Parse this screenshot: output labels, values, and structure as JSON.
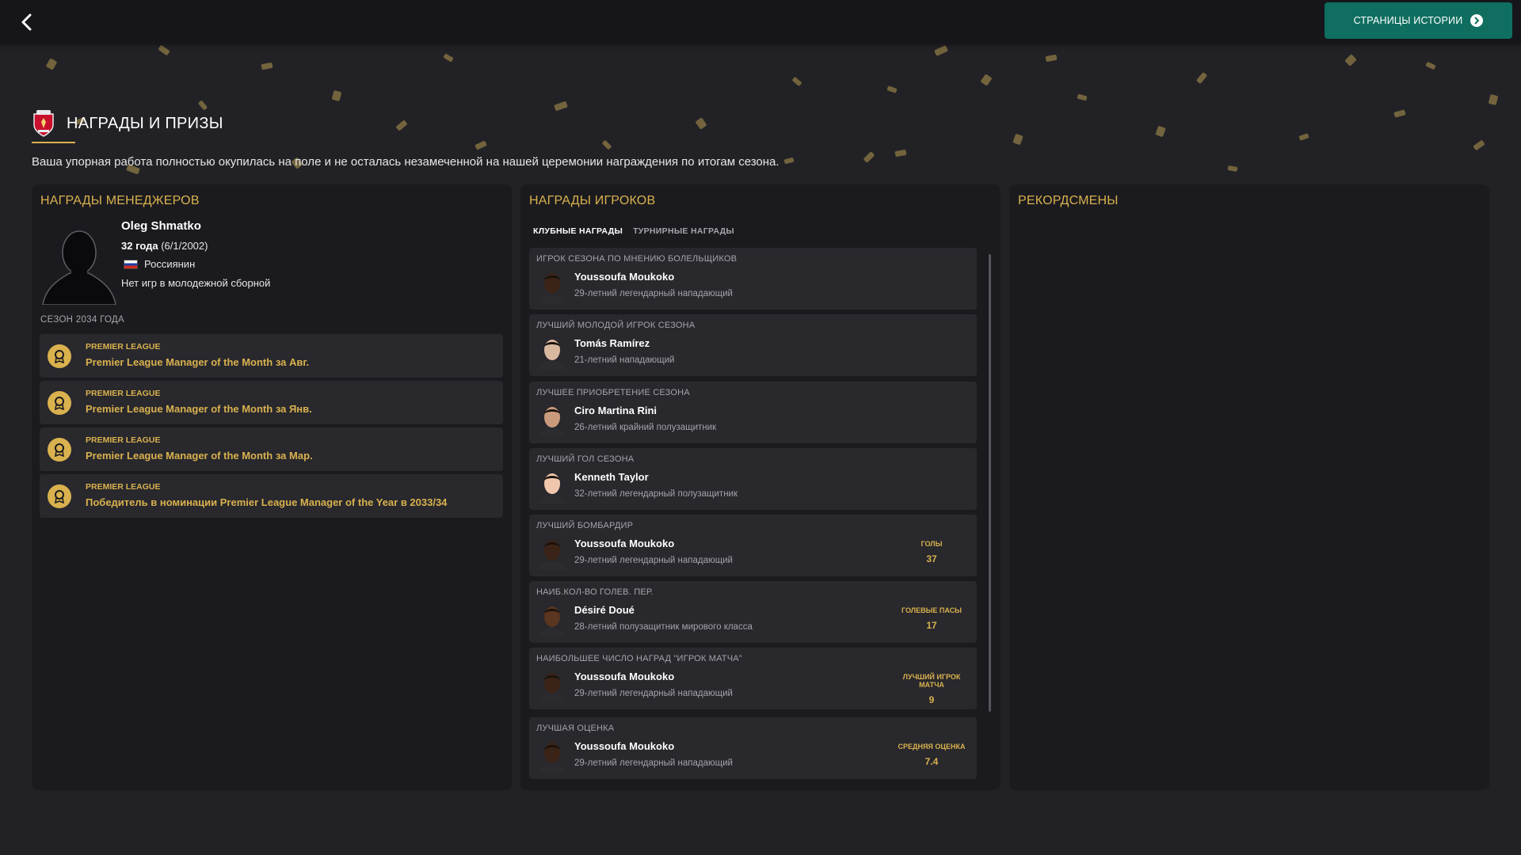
{
  "topbar": {
    "history_label": "СТРАНИЦЫ ИСТОРИИ"
  },
  "header": {
    "title": "НАГРАДЫ И ПРИЗЫ",
    "subtitle": "Ваша упорная работа полностью окупилась на поле и не осталась незамеченной на нашей церемонии награждения по итогам сезона."
  },
  "managers": {
    "title": "НАГРАДЫ МЕНЕДЖЕРОВ",
    "name": "Oleg Shmatko",
    "age": "32 года",
    "dob": "(6/1/2002)",
    "nationality": "Россиянин",
    "youth_caps": "Нет игр в молодежной сборной",
    "season_label": "СЕЗОН 2034 ГОДА",
    "awards": [
      {
        "league": "PREMIER LEAGUE",
        "text": "Premier League Manager of the Month за Авг."
      },
      {
        "league": "PREMIER LEAGUE",
        "text": "Premier League Manager of the Month за Янв."
      },
      {
        "league": "PREMIER LEAGUE",
        "text": "Premier League Manager of the Month за Мар."
      },
      {
        "league": "PREMIER LEAGUE",
        "text": "Победитель в номинации Premier League Manager of the Year в 2033/34"
      }
    ]
  },
  "players": {
    "title": "НАГРАДЫ ИГРОКОВ",
    "tabs": [
      {
        "label": "КЛУБНЫЕ НАГРАДЫ",
        "active": true
      },
      {
        "label": "ТУРНИРНЫЕ НАГРАДЫ",
        "active": false
      }
    ],
    "awards": [
      {
        "title": "ИГРОК СЕЗОНА ПО МНЕНИЮ БОЛЕЛЬЩИКОВ",
        "name": "Youssoufa Moukoko",
        "desc": "29-летний легендарный нападающий",
        "skin": "#3b2417"
      },
      {
        "title": "ЛУЧШИЙ МОЛОДОЙ ИГРОК СЕЗОНА",
        "name": "Tomás Ramírez",
        "desc": "21-летний нападающий",
        "skin": "#d9b8a0"
      },
      {
        "title": "ЛУЧШЕЕ ПРИОБРЕТЕНИЕ СЕЗОНА",
        "name": "Ciro Martina Rini",
        "desc": "26-летний крайний полузащитник",
        "skin": "#c99a7c"
      },
      {
        "title": "ЛУЧШИЙ ГОЛ СЕЗОНА",
        "name": "Kenneth Taylor",
        "desc": "32-летний легендарный полузащитник",
        "skin": "#f0c7ad"
      },
      {
        "title": "ЛУЧШИЙ БОМБАРДИР",
        "name": "Youssoufa Moukoko",
        "desc": "29-летний легендарный нападающий",
        "skin": "#3b2417",
        "stat_label": "ГОЛЫ",
        "stat_value": "37"
      },
      {
        "title": "НАИБ.КОЛ-ВО ГОЛЕВ. ПЕР.",
        "name": "Désiré Doué",
        "desc": "28-летний полузащитник мирового класса",
        "skin": "#5a3520",
        "stat_label": "ГОЛЕВЫЕ ПАСЫ",
        "stat_value": "17"
      },
      {
        "title": "НАИБОЛЬШЕЕ ЧИСЛО НАГРАД \"ИГРОК МАТЧА\"",
        "name": "Youssoufa Moukoko",
        "desc": "29-летний легендарный нападающий",
        "skin": "#3b2417",
        "stat_label": "ЛУЧШИЙ ИГРОК МАТЧА",
        "stat_value": "9"
      },
      {
        "title": "ЛУЧШАЯ ОЦЕНКА",
        "name": "Youssoufa Moukoko",
        "desc": "29-летний легендарный нападающий",
        "skin": "#3b2417",
        "stat_label": "СРЕДНЯЯ ОЦЕНКА",
        "stat_value": "7.4"
      }
    ]
  },
  "records": {
    "title": "РЕКОРДСМЕНЫ"
  },
  "colors": {
    "accent_gold": "#d9b14e",
    "button_teal": "#0f6e5f",
    "panel_bg": "#1b1b1f",
    "card_bg": "#28282d"
  },
  "icons": [
    "back-arrow-icon",
    "chevron-right-circle-icon",
    "club-crest-icon",
    "russia-flag-icon",
    "medal-icon"
  ]
}
